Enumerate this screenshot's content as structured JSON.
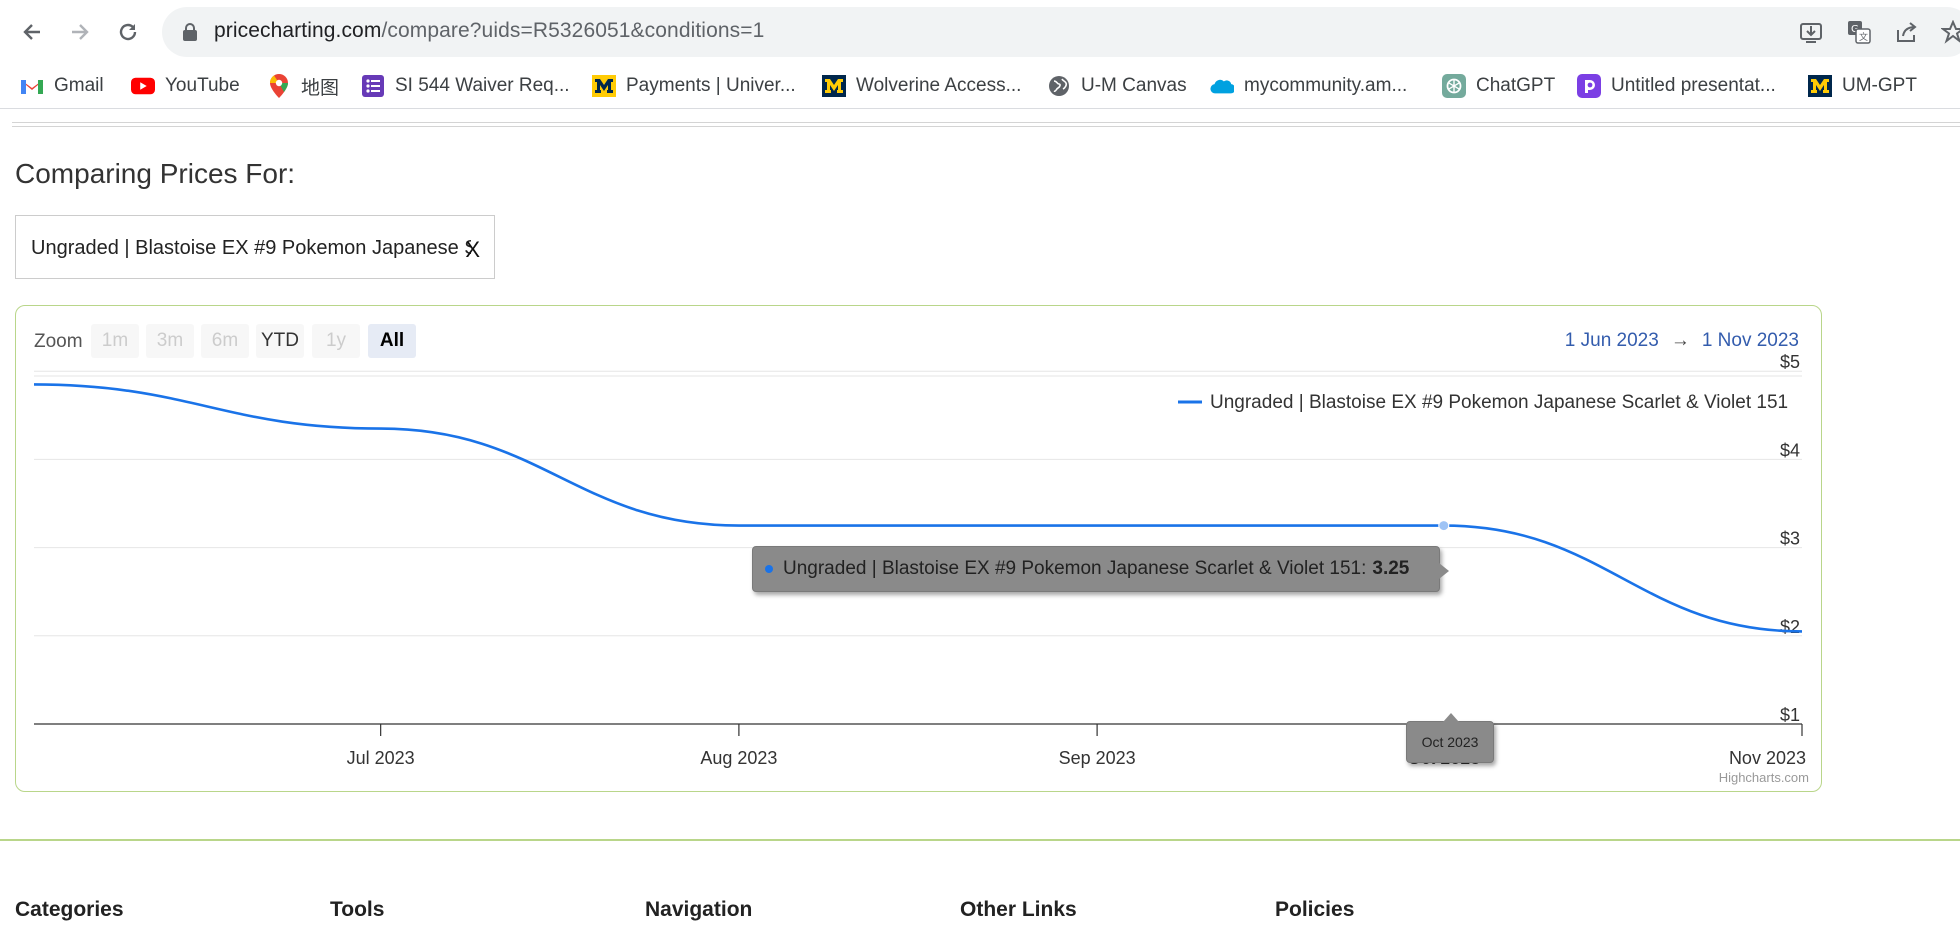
{
  "browser": {
    "url_host": "pricecharting.com",
    "url_path": "/compare?uids=R5326051&conditions=1",
    "bookmarks": [
      {
        "label": "Gmail",
        "icon": "gmail-icon",
        "color": "#EA4335"
      },
      {
        "label": "YouTube",
        "icon": "youtube-icon",
        "color": "#FF0000"
      },
      {
        "label": "地图",
        "icon": "maps-pin-icon",
        "color": "#34A853"
      },
      {
        "label": "SI 544 Waiver Req...",
        "icon": "forms-icon",
        "color": "#673AB7"
      },
      {
        "label": "Payments | Univer...",
        "icon": "umich-block-m-icon",
        "color": "#00274C"
      },
      {
        "label": "Wolverine Access...",
        "icon": "umich-block-m-icon",
        "color": "#00274C"
      },
      {
        "label": "U-M Canvas",
        "icon": "globe-icon",
        "color": "#5f6368"
      },
      {
        "label": "mycommunity.am...",
        "icon": "salesforce-cloud-icon",
        "color": "#00A1E0"
      },
      {
        "label": "ChatGPT",
        "icon": "chatgpt-icon",
        "color": "#10A37F"
      },
      {
        "label": "Untitled presentat...",
        "icon": "presentation-icon",
        "color": "#7B3FE4"
      },
      {
        "label": "UM-GPT",
        "icon": "umich-block-m-icon",
        "color": "#00274C"
      }
    ]
  },
  "page": {
    "title": "Comparing Prices For:",
    "selected_item": "Ungraded | Blastoise EX #9 Pokemon Japanese Scarlet & Violet 151",
    "remove_label": "X"
  },
  "chart": {
    "zoom_label": "Zoom",
    "zoom_buttons": [
      "1m",
      "3m",
      "6m",
      "YTD",
      "1y",
      "All"
    ],
    "range_from": "1 Jun 2023",
    "range_arrow": "→",
    "range_to": "1 Nov 2023",
    "tooltip_series": "Ungraded | Blastoise EX #9 Pokemon Japanese Scarlet & Violet 151:",
    "tooltip_value": "3.25",
    "x_tooltip": "Oct 2023",
    "credits": "Highcharts.com",
    "line_color": "#1a73e8"
  },
  "chart_data": {
    "type": "line",
    "series": [
      {
        "name": "Ungraded | Blastoise EX #9 Pokemon Japanese Scarlet & Violet 151",
        "x": [
          "2023-06-01",
          "2023-07-01",
          "2023-08-01",
          "2023-09-01",
          "2023-10-01",
          "2023-11-01"
        ],
        "values": [
          4.85,
          4.35,
          3.25,
          3.25,
          3.25,
          2.05
        ]
      }
    ],
    "x_ticks": [
      "Jul 2023",
      "Aug 2023",
      "Sep 2023",
      "Oct 2023",
      "Nov 2023"
    ],
    "y_ticks": [
      "$1",
      "$2",
      "$3",
      "$4",
      "$5"
    ],
    "ylim": [
      1,
      5.15
    ],
    "legend": "top-right",
    "grid": true
  },
  "footer": {
    "headings": [
      "Categories",
      "Tools",
      "Navigation",
      "Other Links",
      "Policies"
    ]
  }
}
